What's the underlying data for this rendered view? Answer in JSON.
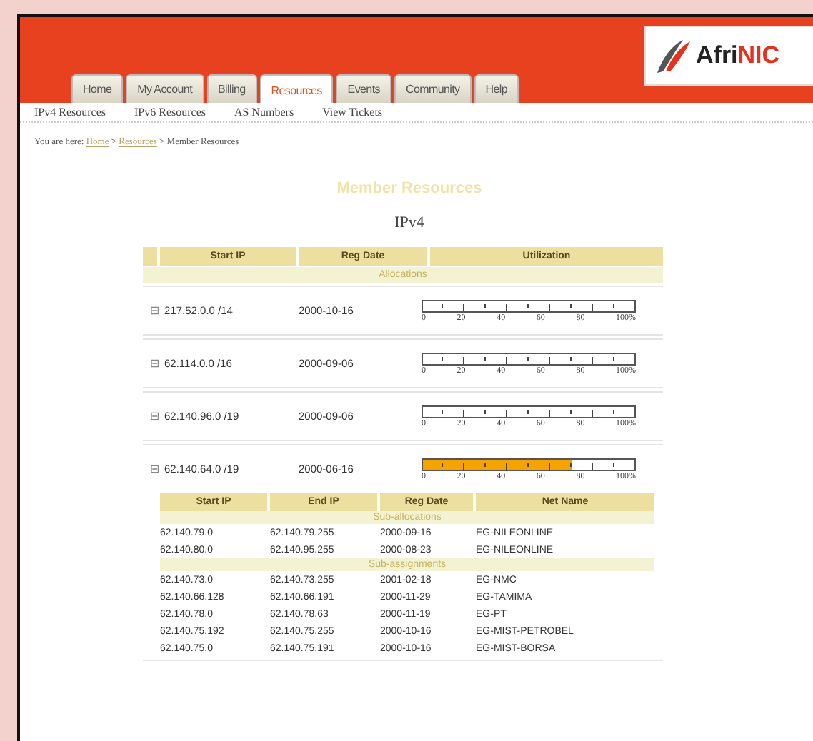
{
  "logo": {
    "text_dark": "Afri",
    "text_accent": "NIC"
  },
  "tabs": [
    {
      "label": "Home",
      "selected": false
    },
    {
      "label": "My Account",
      "selected": false
    },
    {
      "label": "Billing",
      "selected": false
    },
    {
      "label": "Resources",
      "selected": true
    },
    {
      "label": "Events",
      "selected": false
    },
    {
      "label": "Community",
      "selected": false
    },
    {
      "label": "Help",
      "selected": false
    }
  ],
  "subnav": [
    "IPv4 Resources",
    "IPv6 Resources",
    "AS Numbers",
    "View Tickets"
  ],
  "breadcrumb": {
    "prefix": "You are here:",
    "links": [
      "Home",
      "Resources"
    ],
    "separator": ">",
    "current": "Member Resources"
  },
  "page_title": "Member Resources",
  "section_title": "IPv4",
  "table": {
    "columns": [
      "Start IP",
      "Reg Date",
      "Utilization"
    ],
    "group": "Allocations",
    "rows": [
      {
        "toggle": "⊟",
        "start_ip": "217.52.0.0 /14",
        "reg_date": "2000-10-16",
        "level": 0,
        "scale": [
          "0",
          "20",
          "40",
          "60",
          "80",
          "100%"
        ]
      },
      {
        "toggle": "⊟",
        "start_ip": "62.114.0.0 /16",
        "reg_date": "2000-09-06",
        "level": 0,
        "scale": [
          "0",
          "20",
          "40",
          "60",
          "80",
          "100%"
        ]
      },
      {
        "toggle": "⊟",
        "start_ip": "62.140.96.0 /19",
        "reg_date": "2000-09-06",
        "level": 0,
        "scale": [
          "0",
          "20",
          "40",
          "60",
          "80",
          "100%"
        ]
      },
      {
        "toggle": "⊟",
        "start_ip": "62.140.64.0 /19",
        "reg_date": "2000-06-16",
        "level": 0.7,
        "expanded": true,
        "scale": [
          "0",
          "20",
          "40",
          "60",
          "80",
          "100%"
        ]
      }
    ]
  },
  "subtable": {
    "columns": [
      "Start IP",
      "End IP",
      "Reg Date",
      "Net Name"
    ],
    "groups": [
      {
        "title": "Sub-allocations",
        "rows": [
          [
            "62.140.79.0",
            "62.140.79.255",
            "2000-09-16",
            "EG-NILEONLINE"
          ],
          [
            "62.140.80.0",
            "62.140.95.255",
            "2000-08-23",
            "EG-NILEONLINE"
          ]
        ]
      },
      {
        "title": "Sub-assignments",
        "rows": [
          [
            "62.140.73.0",
            "62.140.73.255",
            "2001-02-18",
            "EG-NMC"
          ],
          [
            "62.140.66.128",
            "62.140.66.191",
            "2000-11-29",
            "EG-TAMIMA"
          ],
          [
            "62.140.78.0",
            "62.140.78.63",
            "2000-11-19",
            "EG-PT"
          ],
          [
            "62.140.75.192",
            "62.140.75.255",
            "2000-10-16",
            "EG-MIST-PETROBEL"
          ],
          [
            "62.140.75.0",
            "62.140.75.191",
            "2000-10-16",
            "EG-MIST-BORSA"
          ]
        ]
      }
    ]
  }
}
